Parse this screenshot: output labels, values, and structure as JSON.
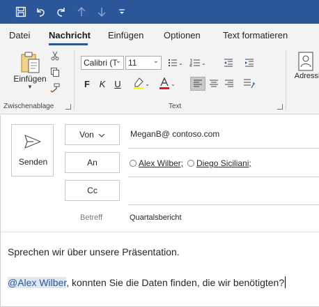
{
  "qat": {
    "icons": [
      "save-icon",
      "undo-icon",
      "redo-icon",
      "up-arrow-icon",
      "down-arrow-icon",
      "customize-qat-icon"
    ]
  },
  "tabs": [
    {
      "label": "Datei",
      "active": false
    },
    {
      "label": "Nachricht",
      "active": true
    },
    {
      "label": "Einfügen",
      "active": false
    },
    {
      "label": "Optionen",
      "active": false
    },
    {
      "label": "Text formatieren",
      "active": false
    }
  ],
  "ribbon": {
    "clipboard": {
      "paste_label": "Einfügen",
      "group_label": "Zwischenablage"
    },
    "text": {
      "font_name": "Calibri (T",
      "font_size": "11",
      "bold": "F",
      "italic": "K",
      "underline": "U",
      "group_label": "Text",
      "highlight_color": "#ffff00",
      "font_color": "#e81123"
    },
    "names": {
      "address_book_label": "Adressbu"
    }
  },
  "compose": {
    "send_label": "Senden",
    "from_label": "Von",
    "from_value": "MeganB@ contoso.com",
    "to_label": "An",
    "recipients": [
      "Alex Wilber;",
      "Diego Siciliani;"
    ],
    "cc_label": "Cc",
    "subject_label": "Betreff",
    "subject_value": "Quartalsbericht",
    "body_line1": "Sprechen wir über unsere Präsentation.",
    "mention": "@Alex Wilber",
    "body_line2_rest": ", konnten Sie die Daten finden, die wir benötigten?"
  },
  "colors": {
    "title_bar": "#2b579a",
    "ribbon_bg": "#f3f3f3",
    "mention_bg": "#dfe7f1"
  }
}
